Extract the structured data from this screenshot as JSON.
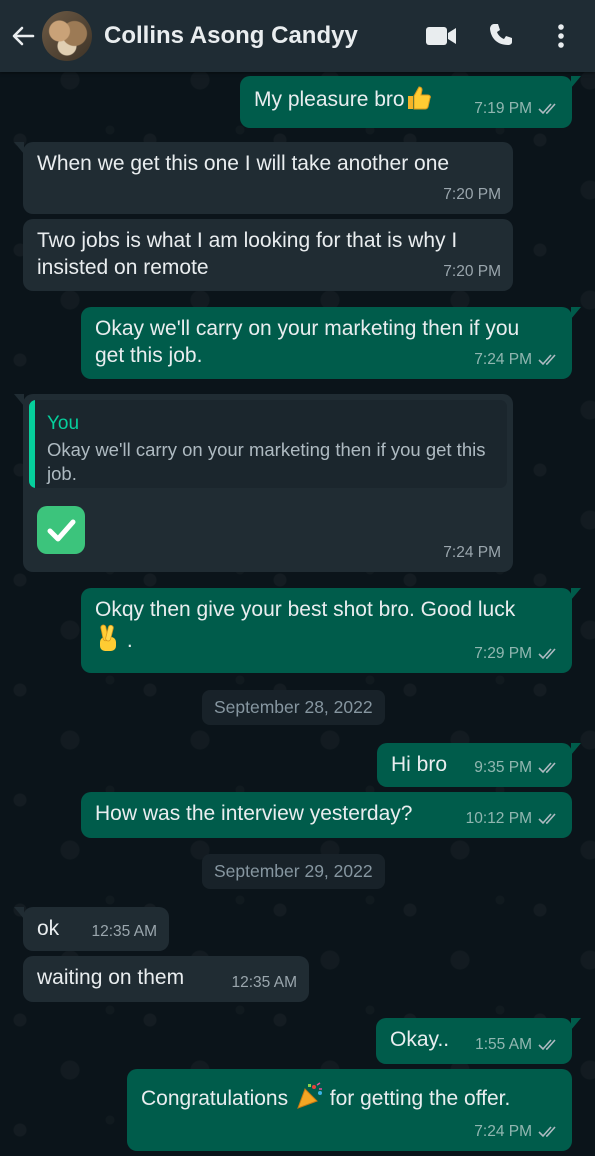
{
  "header": {
    "contact_name": "Collins Asong Candyy",
    "icons": [
      "back-arrow-icon",
      "video-call-icon",
      "voice-call-icon",
      "more-options-icon"
    ]
  },
  "colors": {
    "header_bg": "#1f2c34",
    "chat_bg": "#0b141a",
    "incoming_bubble": "#202c33",
    "outgoing_bubble": "#005c4b",
    "quote_accent": "#06cf9c",
    "read_ticks": "#9aa6ad"
  },
  "messages": [
    {
      "direction": "out",
      "text": "My pleasure bro",
      "emoji": "thumbs-up",
      "time": "7:19 PM",
      "status": "delivered"
    },
    {
      "direction": "in",
      "text": "When we get this one I will take another one",
      "time": "7:20 PM"
    },
    {
      "direction": "in",
      "text": "Two jobs is what I am looking for that is why I insisted on remote",
      "time": "7:20 PM"
    },
    {
      "direction": "out",
      "text": "Okay we'll carry on your marketing then if you get this job.",
      "time": "7:24 PM",
      "status": "delivered"
    },
    {
      "direction": "in",
      "reply_to_author": "You",
      "reply_to_text": "Okay we'll carry on your marketing then if you get this job.",
      "emoji": "check-mark-button",
      "time": "7:24 PM"
    },
    {
      "direction": "out",
      "text": "Okqy then give your best shot bro. Good luck",
      "emoji": "crossed-fingers",
      "text_after_emoji": ".",
      "time": "7:29 PM",
      "status": "delivered"
    },
    {
      "date_divider": "September 28, 2022"
    },
    {
      "direction": "out",
      "text": "Hi bro",
      "time": "9:35 PM",
      "status": "delivered"
    },
    {
      "direction": "out",
      "text": "How was the interview yesterday?",
      "time": "10:12 PM",
      "status": "delivered"
    },
    {
      "date_divider": "September 29, 2022"
    },
    {
      "direction": "in",
      "text": "ok",
      "time": "12:35 AM"
    },
    {
      "direction": "in",
      "text": "waiting on them",
      "time": "12:35 AM"
    },
    {
      "direction": "out",
      "text": "Okay..",
      "time": "1:55 AM",
      "status": "delivered"
    },
    {
      "direction": "out",
      "text": "Congratulations",
      "emoji": "party-popper",
      "text_after_emoji": "for getting the offer.",
      "time": "7:24 PM",
      "status": "delivered"
    }
  ]
}
